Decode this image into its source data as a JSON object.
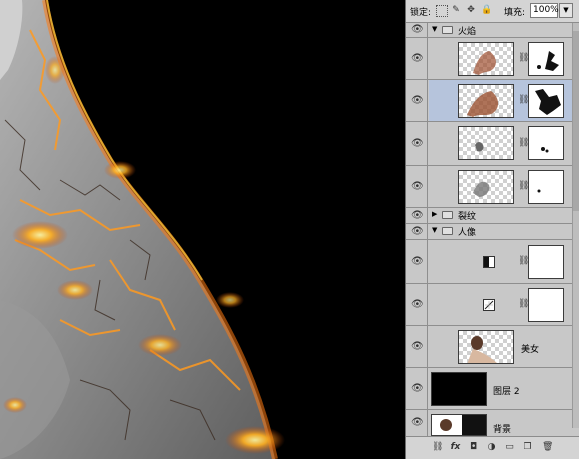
{
  "toolbar": {
    "lock_label": "锁定:",
    "fill_label": "填充:",
    "fill_value": "100%",
    "icons": [
      "lock-transparent-icon",
      "brush-icon",
      "move-icon",
      "padlock-icon"
    ]
  },
  "layers": [
    {
      "kind": "group",
      "name": "火焰",
      "expanded": true
    },
    {
      "kind": "layer",
      "thumb": "fire-figure",
      "mask": "black-splatter"
    },
    {
      "kind": "layer",
      "thumb": "fire-figure",
      "mask": "black-splatter",
      "selected": true
    },
    {
      "kind": "layer",
      "thumb": "small-figure",
      "mask": "small-dots"
    },
    {
      "kind": "layer",
      "thumb": "small-figure",
      "mask": "tiny-dot"
    },
    {
      "kind": "group",
      "name": "裂纹",
      "expanded": false
    },
    {
      "kind": "group",
      "name": "人像",
      "expanded": true
    },
    {
      "kind": "adjustment",
      "icon": "levels-icon",
      "mask": "white"
    },
    {
      "kind": "adjustment",
      "icon": "curves-icon",
      "mask": "white"
    },
    {
      "kind": "layer",
      "thumb": "portrait",
      "name": "美女"
    },
    {
      "kind": "layer",
      "thumb": "black",
      "name": "图层 2"
    },
    {
      "kind": "layer",
      "thumb": "portrait-partial",
      "name": "背景"
    }
  ],
  "bottom_bar": {
    "icons": [
      "link-layers-icon",
      "fx-icon",
      "add-mask-icon",
      "adjustment-layer-icon",
      "new-group-icon",
      "new-layer-icon",
      "delete-icon"
    ],
    "fx_label": "fx"
  }
}
